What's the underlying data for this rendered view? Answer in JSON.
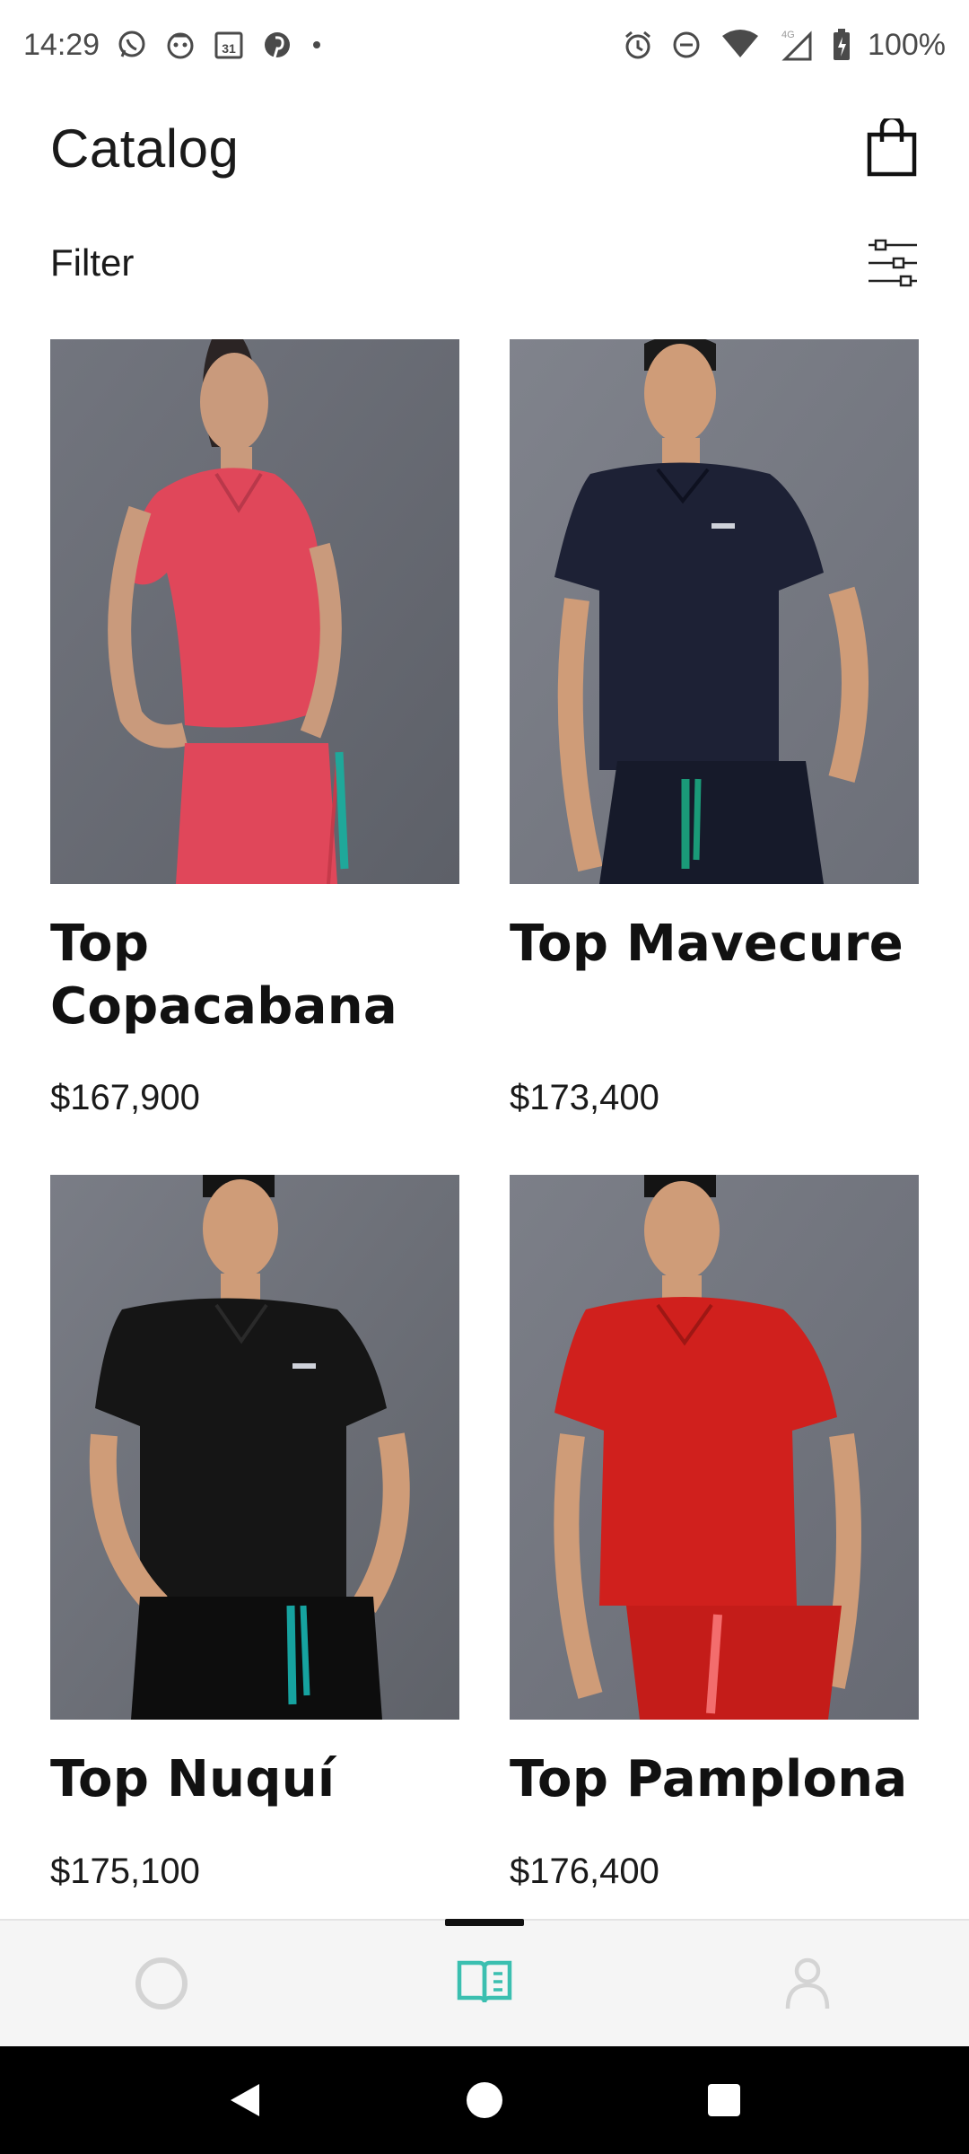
{
  "status_bar": {
    "time": "14:29",
    "battery": "100%",
    "left_icons": [
      "whatsapp-icon",
      "bot-icon",
      "calendar-icon",
      "pinterest-icon",
      "dot-icon"
    ],
    "right_icons": [
      "alarm-icon",
      "dnd-icon",
      "wifi-icon",
      "signal-icon",
      "battery-icon"
    ],
    "network_label": "4G"
  },
  "header": {
    "title": "Catalog",
    "cart_icon": "shopping-bag-icon"
  },
  "filter": {
    "label": "Filter",
    "icon": "sliders-icon"
  },
  "products": [
    {
      "name": "Top Copacabana",
      "price": "$167,900",
      "color": "#e0475a",
      "accent": "#1fa89a",
      "skin": "#c99a7c"
    },
    {
      "name": "Top Mavecure",
      "price": "$173,400",
      "color": "#1d2135",
      "accent": "#1a9a78",
      "skin": "#cf9c78"
    },
    {
      "name": "Top Nuquí",
      "price": "$175,100",
      "color": "#151515",
      "accent": "#16a3a0",
      "skin": "#cf9c78"
    },
    {
      "name": "Top Pamplona",
      "price": "$176,400",
      "color": "#d0201d",
      "accent": "#f36d6d",
      "skin": "#cf9c78"
    }
  ],
  "bottom_nav": {
    "items": [
      "home-icon",
      "catalog-icon",
      "profile-icon"
    ],
    "active": 1,
    "accent_color": "#3bbfb0"
  },
  "system_nav": [
    "back-icon",
    "home-circle-icon",
    "recents-icon"
  ]
}
